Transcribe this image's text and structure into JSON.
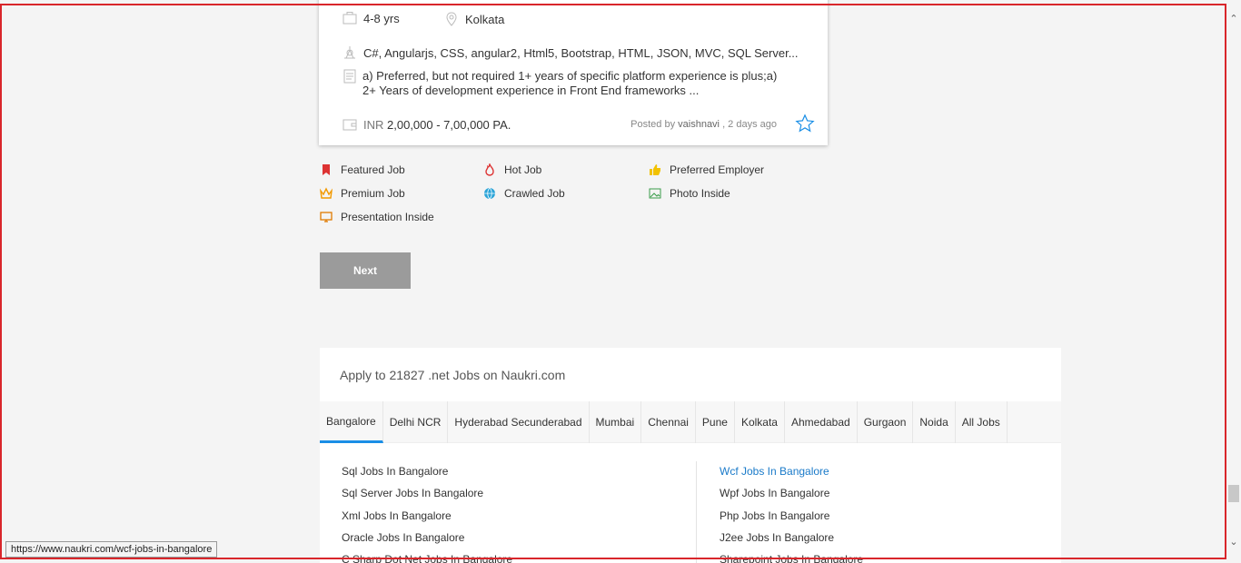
{
  "job": {
    "experience": "4-8 yrs",
    "location": "Kolkata",
    "skills": "C#, Angularjs, CSS, angular2, Html5, Bootstrap, HTML, JSON, MVC, SQL Server...",
    "description": "a) Preferred, but not required 1+ years of specific platform experience is plus;a) 2+ Years of development experience in Front End frameworks ...",
    "salary_currency": "INR",
    "salary": "2,00,000 - 7,00,000 PA.",
    "posted_prefix": "Posted by",
    "posted_by": "vaishnavi",
    "posted_when": ", 2 days ago"
  },
  "legend": {
    "featured": "Featured Job",
    "hot": "Hot Job",
    "preferred": "Preferred Employer",
    "premium": "Premium Job",
    "crawled": "Crawled Job",
    "photo": "Photo Inside",
    "presentation": "Presentation Inside"
  },
  "pagination": {
    "next_label": "Next"
  },
  "apply": {
    "title": "Apply to 21827 .net Jobs on Naukri.com",
    "tabs": [
      "Bangalore",
      "Delhi NCR",
      "Hyderabad Secunderabad",
      "Mumbai",
      "Chennai",
      "Pune",
      "Kolkata",
      "Ahmedabad",
      "Gurgaon",
      "Noida",
      "All Jobs"
    ],
    "left_links": [
      "Sql Jobs In Bangalore",
      "Sql Server Jobs In Bangalore",
      "Xml Jobs In Bangalore",
      "Oracle Jobs In Bangalore",
      "C Sharp Dot Net Jobs In Bangalore"
    ],
    "right_links": [
      "Wcf Jobs In Bangalore",
      "Wpf Jobs In Bangalore",
      "Php Jobs In Bangalore",
      "J2ee Jobs In Bangalore",
      "Sharepoint Jobs In Bangalore"
    ]
  },
  "status_url": "https://www.naukri.com/wcf-jobs-in-bangalore",
  "colors": {
    "accent": "#1a8ee6",
    "link_hover": "#1a7ac9",
    "frame": "#d9262b",
    "button": "#9b9b9b"
  }
}
